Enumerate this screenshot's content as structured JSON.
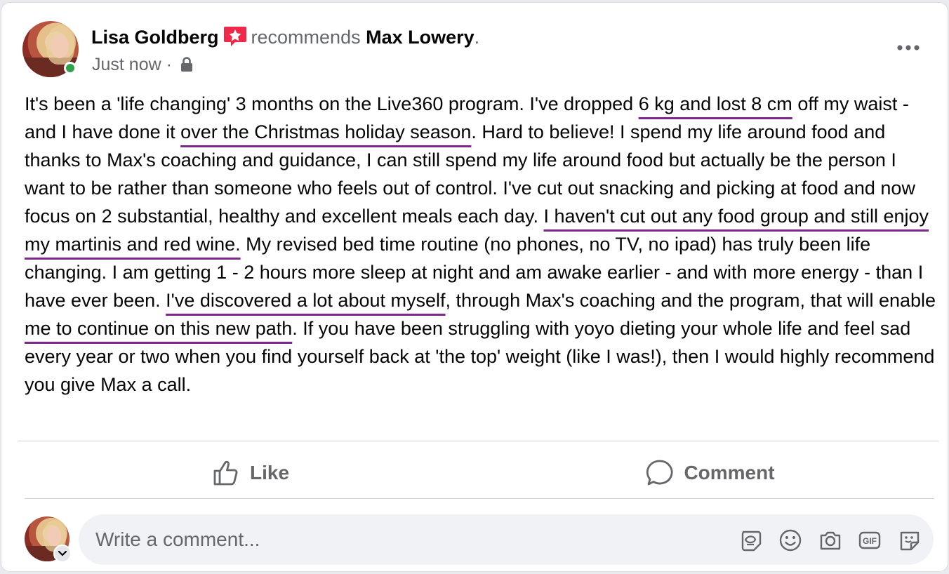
{
  "post": {
    "author": "Lisa Goldberg",
    "verb": "recommends",
    "page_name": "Max Lowery",
    "period": ".",
    "timestamp": "Just now",
    "separator": "·",
    "segments": [
      {
        "text": "It's been a 'life changing' 3 months on the Live360 program. I've dropped ",
        "hl": false
      },
      {
        "text": "6 kg and lost 8 cm",
        "hl": true
      },
      {
        "text": " off my waist - and I have done it ",
        "hl": false
      },
      {
        "text": "over the Christmas holiday season",
        "hl": true
      },
      {
        "text": ". Hard to believe! I spend my life around food and thanks to Max's coaching and guidance, I can still spend my life around food but actually be the person I want to be rather than someone who feels out of control. I've cut out snacking and picking at food and now focus on 2 substantial, healthy and excellent meals each day. ",
        "hl": false
      },
      {
        "text": "I haven't cut out any food group and still enjoy my martinis and red wine.",
        "hl": true
      },
      {
        "text": " My revised bed time routine (no phones, no TV, no ipad) has truly been life changing. I am getting 1 - 2 hours more sleep at night and am awake earlier - and with more energy - than I have ever been. ",
        "hl": false
      },
      {
        "text": "I've discovered a lot about myself",
        "hl": true
      },
      {
        "text": ", through Max's coaching and the program, that will enable ",
        "hl": false
      },
      {
        "text": "me to continue on this new path",
        "hl": true
      },
      {
        "text": ". If you have been struggling with yoyo dieting your whole life and feel sad every year or two when you find yourself back at 'the top' weight (like I was!), then I would highly recommend you give Max a call.",
        "hl": false
      }
    ]
  },
  "actions": {
    "like_label": "Like",
    "comment_label": "Comment"
  },
  "composer": {
    "placeholder": "Write a comment..."
  },
  "icons": {
    "recommend_badge": "recommend-star-icon",
    "privacy": "lock-icon",
    "more": "more-options-icon",
    "like": "thumbs-up-icon",
    "comment": "speech-bubble-icon",
    "avatar_sticker": "avatar-sticker-icon",
    "emoji": "smiley-icon",
    "camera": "camera-icon",
    "gif": "gif-icon",
    "sticker": "sticker-icon",
    "chevron": "chevron-down-icon"
  },
  "colors": {
    "highlight_underline": "#7b2a8a",
    "recommend_badge": "#f02849",
    "online_dot": "#31a24c",
    "secondary_text": "#65676b"
  }
}
